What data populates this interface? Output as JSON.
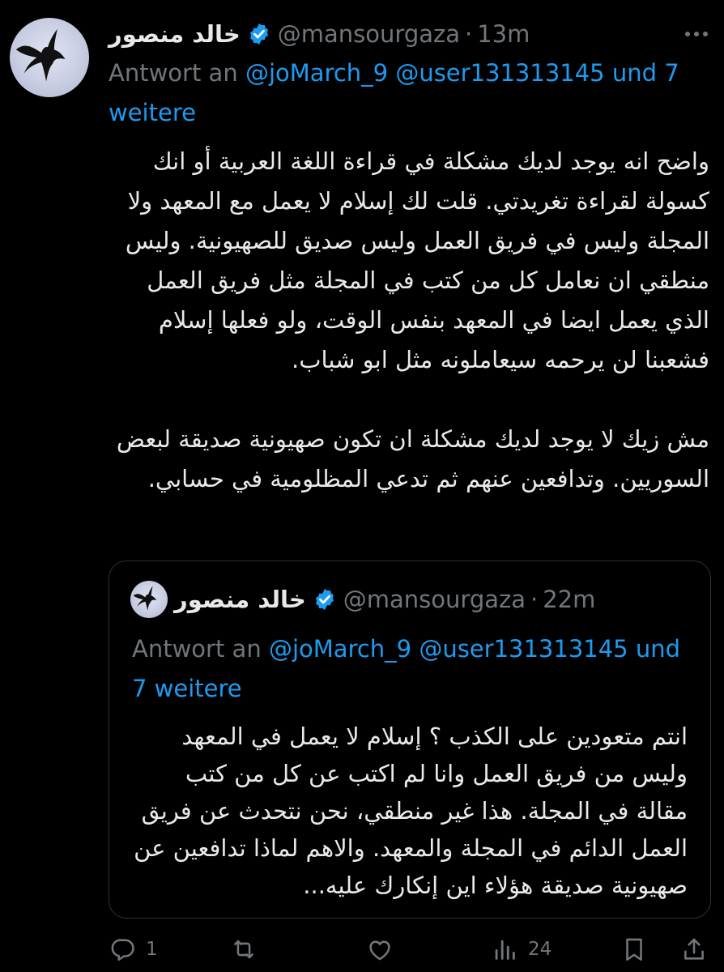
{
  "tweet": {
    "author_name": "خالد منصور",
    "handle": "@mansourgaza",
    "separator": "·",
    "time": "13m",
    "reply_prefix": "Antwort an",
    "reply_mention_1": "@joMarch_9",
    "reply_mention_2": "@user131313145",
    "reply_more": "und 7 weitere",
    "body_paragraph_1": "واضح انه يوجد لديك مشكلة في قراءة اللغة العربية أو انك كسولة لقراءة تغريدتي. قلت لك إسلام لا يعمل مع المعهد ولا المجلة وليس في فريق العمل وليس صديق للصهيونية. وليس منطقي ان نعامل كل من كتب في المجلة مثل فريق العمل الذي يعمل ايضا في المعهد بنفس الوقت، ولو فعلها إسلام فشعبنا لن يرحمه سيعاملونه مثل ابو شباب.",
    "body_paragraph_2": "مش زيك لا يوجد لديك مشكلة ان تكون صهيونية صديقة لبعض السوريين. وتدافعين عنهم ثم تدعي المظلومية في حسابي."
  },
  "quoted_tweet": {
    "author_name": "خالد منصور",
    "handle": "@mansourgaza",
    "separator": "·",
    "time": "22m",
    "reply_prefix": "Antwort an",
    "reply_mention_1": "@joMarch_9",
    "reply_mention_2": "@user131313145",
    "reply_more": "und 7 weitere",
    "body": "انتم متعودين على الكذب ؟ إسلام لا يعمل في المعهد وليس من فريق العمل وانا لم اكتب عن كل من كتب مقالة في المجلة. هذا غير منطقي، نحن نتحدث عن فريق العمل الدائم في المجلة والمعهد. والاهم لماذا تدافعين عن صهيونية صديقة هؤلاء اين إنكارك عليه..."
  },
  "actions": {
    "reply_count": "1",
    "retweet_count": "",
    "like_count": "",
    "views_count": "24"
  },
  "icons": {
    "avatar": "bird-silhouette-avatar",
    "verified": "verified-badge-icon",
    "more": "more-icon",
    "reply": "reply-icon",
    "retweet": "retweet-icon",
    "like": "heart-icon",
    "views": "views-icon",
    "bookmark": "bookmark-icon",
    "share": "share-icon"
  },
  "colors": {
    "background": "#000000",
    "text": "#e7e9ea",
    "muted": "#71767b",
    "link": "#1d9bf0",
    "border": "#2f3336"
  }
}
